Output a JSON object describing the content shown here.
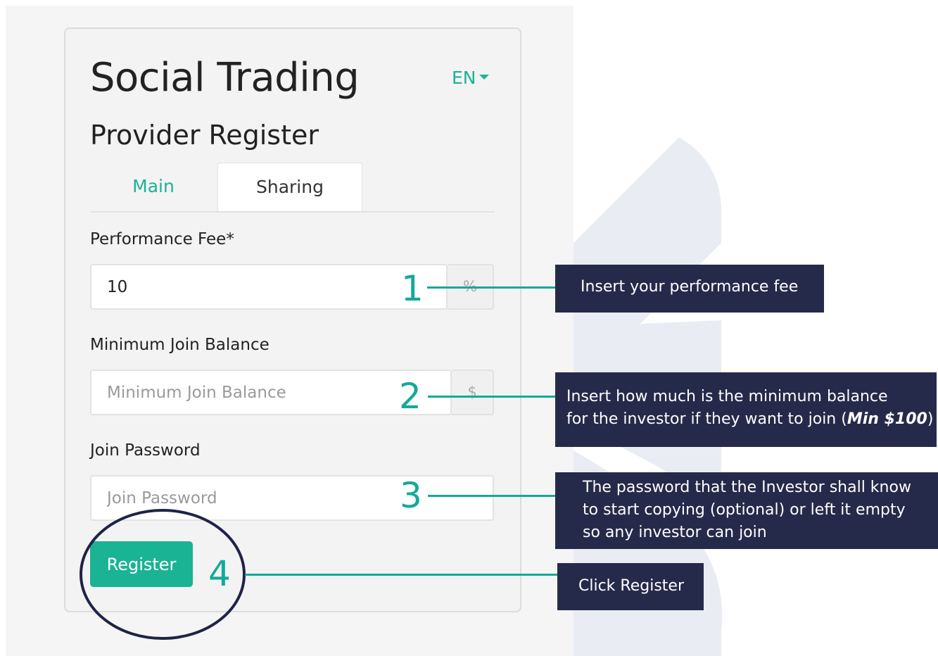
{
  "header": {
    "app_title": "Social Trading",
    "language": "EN",
    "page_subtitle": "Provider Register"
  },
  "tabs": [
    {
      "label": "Main",
      "active": false
    },
    {
      "label": "Sharing",
      "active": true
    }
  ],
  "form": {
    "performance_fee": {
      "label": "Performance Fee*",
      "value": "10",
      "addon": "%"
    },
    "min_join_balance": {
      "label": "Minimum Join Balance",
      "placeholder": "Minimum Join Balance",
      "addon": "$"
    },
    "join_password": {
      "label": "Join Password",
      "placeholder": "Join Password"
    },
    "register_label": "Register"
  },
  "callouts": [
    {
      "number": "1",
      "text": "Insert your performance fee"
    },
    {
      "number": "2",
      "line1": "Insert how much is the minimum balance",
      "line2_prefix": "for the investor if they want to join (",
      "line2_bold": "Min $100",
      "line2_suffix": ")"
    },
    {
      "number": "3",
      "line1": "The password that the Investor shall know",
      "line2": "to start copying (optional) or left it empty",
      "line3": "so any investor can join"
    },
    {
      "number": "4",
      "text": "Click Register"
    }
  ],
  "colors": {
    "accent": "#1ab394",
    "annotation": "#14a99a",
    "callout_bg": "#262a4a",
    "decor": "#e9ecf3",
    "circle": "#1f2347"
  }
}
